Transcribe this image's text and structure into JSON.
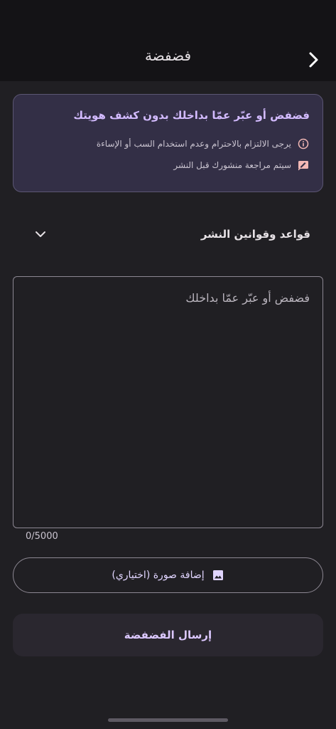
{
  "appbar": {
    "title": "فضفضة",
    "back_icon": "chevron-right-icon"
  },
  "info_card": {
    "title": "فضفض أو عبّر عمّا بداخلك بدون كشف هويتك",
    "rows": [
      {
        "icon": "info-icon",
        "text": "يرجى الالتزام بالاحترام وعدم استخدام السب أو الإساءة"
      },
      {
        "icon": "review-icon",
        "text": "سيتم مراجعة منشورك قبل النشر"
      }
    ]
  },
  "rules": {
    "label": "قواعد وقوانين النشر",
    "icon": "chevron-down-icon"
  },
  "composer": {
    "placeholder": "فضفض أو عبّر عمّا بداخلك",
    "counter": "0/5000"
  },
  "image_button": {
    "label": "إضافة صورة (اختياري)",
    "icon": "image-icon"
  },
  "send_button": {
    "label": "إرسال الفضفضة"
  },
  "colors": {
    "background": "#201f23",
    "appbar": "#141316",
    "accent": "#d3bbff",
    "card": "#332f46"
  }
}
